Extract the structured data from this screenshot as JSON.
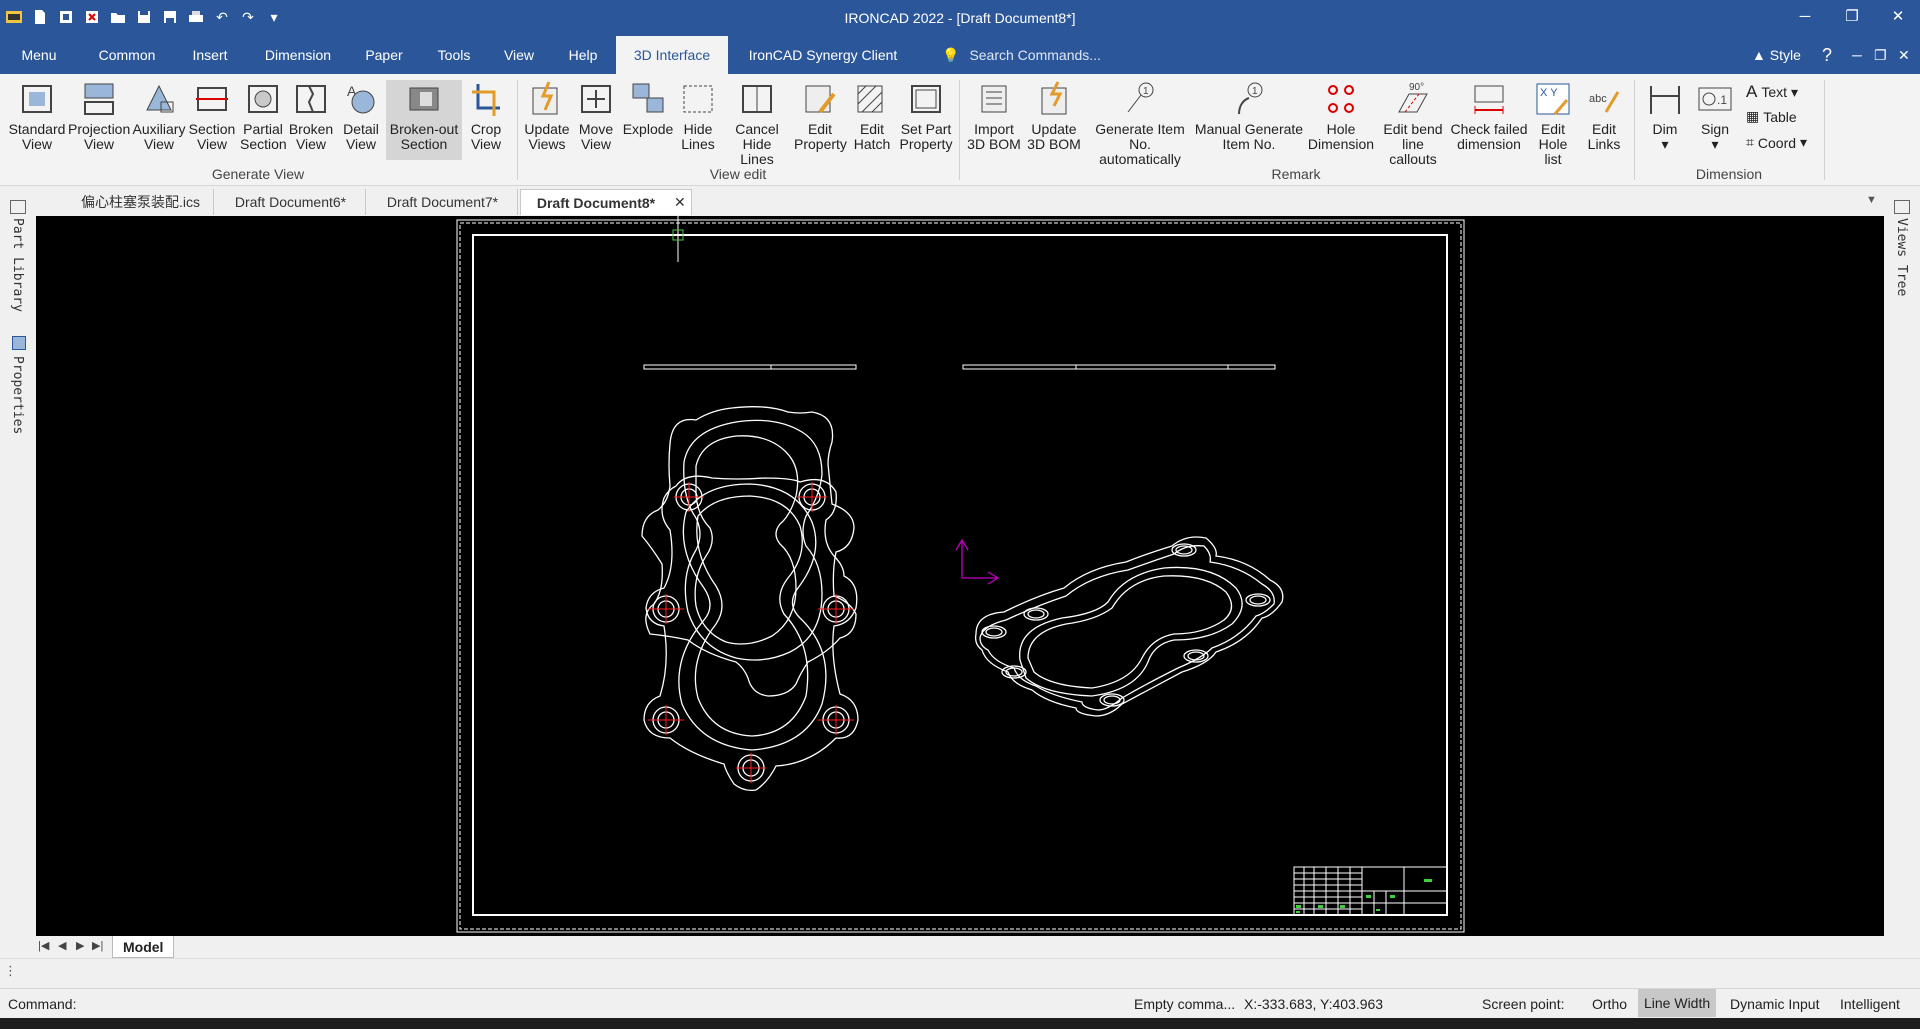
{
  "window": {
    "title": "IRONCAD 2022 - [Draft Document8*]"
  },
  "menu_tabs": [
    "Menu",
    "Common",
    "Insert",
    "Dimension",
    "Paper",
    "Tools",
    "View",
    "Help",
    "3D Interface",
    "IronCAD Synergy Client"
  ],
  "active_menu_tab": "3D Interface",
  "search": {
    "placeholder": "Search Commands..."
  },
  "style_label": "Style",
  "ribbon": {
    "generate_view": {
      "label": "Generate View",
      "buttons": [
        {
          "line1": "Standard",
          "line2": "View"
        },
        {
          "line1": "Projection",
          "line2": "View"
        },
        {
          "line1": "Auxiliary",
          "line2": "View"
        },
        {
          "line1": "Section",
          "line2": "View"
        },
        {
          "line1": "Partial",
          "line2": "Section"
        },
        {
          "line1": "Broken",
          "line2": "View"
        },
        {
          "line1": "Detail",
          "line2": "View"
        },
        {
          "line1": "Broken-out",
          "line2": "Section"
        },
        {
          "line1": "Crop",
          "line2": "View"
        }
      ]
    },
    "view_edit": {
      "label": "View edit",
      "buttons": [
        {
          "line1": "Update",
          "line2": "Views"
        },
        {
          "line1": "Move",
          "line2": "View"
        },
        {
          "line1": "Explode",
          "line2": ""
        },
        {
          "line1": "Hide",
          "line2": "Lines"
        },
        {
          "line1": "Cancel",
          "line2": "Hide Lines"
        },
        {
          "line1": "Edit",
          "line2": "Property"
        },
        {
          "line1": "Edit",
          "line2": "Hatch"
        },
        {
          "line1": "Set Part",
          "line2": "Property"
        }
      ]
    },
    "remark": {
      "label": "Remark",
      "buttons": [
        {
          "line1": "Import",
          "line2": "3D BOM"
        },
        {
          "line1": "Update",
          "line2": "3D BOM"
        },
        {
          "line1": "Generate Item",
          "line2": "No. automatically"
        },
        {
          "line1": "Manual Generate",
          "line2": "Item No."
        },
        {
          "line1": "Hole",
          "line2": "Dimension"
        },
        {
          "line1": "Edit bend",
          "line2": "line callouts"
        },
        {
          "line1": "Check failed",
          "line2": "dimension"
        },
        {
          "line1": "Edit",
          "line2": "Hole list"
        },
        {
          "line1": "Edit",
          "line2": "Links"
        }
      ]
    },
    "dimension": {
      "label": "Dimension",
      "dim": "Dim",
      "sign": "Sign",
      "text": "Text",
      "table": "Table",
      "coord": "Coord"
    }
  },
  "doc_tabs": [
    "偏心柱塞泵装配.ics",
    "Draft Document6*",
    "Draft Document7*",
    "Draft Document8*"
  ],
  "active_doc_tab": "Draft Document8*",
  "side_panels": {
    "left_top": "Part Library",
    "left_bottom": "Properties",
    "right": "Views Tree"
  },
  "sheet_tab": "Model",
  "command": {
    "label": "Command:"
  },
  "status": {
    "message": "Empty comma...",
    "coords": "X:-333.683, Y:403.963",
    "screen_point": "Screen point:",
    "ortho": "Ortho",
    "line_width": "Line Width",
    "dynamic_input": "Dynamic Input",
    "intelligent": "Intelligent"
  },
  "colors": {
    "accent": "#2b579a",
    "canvas": "#000000",
    "centerline": "#ff2020",
    "axis": "#c000c0"
  }
}
